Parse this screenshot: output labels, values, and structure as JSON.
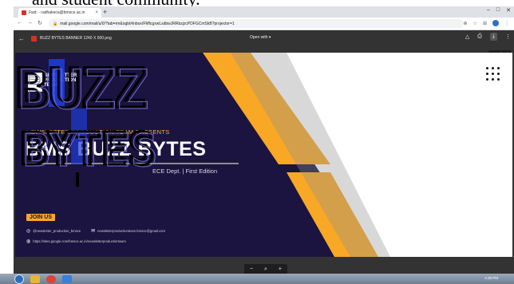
{
  "document": {
    "caption": "and student community."
  },
  "browser": {
    "tab_title": "Fwd: - radhakeca@bmsce.ac.in",
    "tab_close": "×",
    "new_tab": "+",
    "url": "mail.google.com/mail/u/0/?tab=rm&ogbl#inbox/FMfcgxwLsdbwJRRbzjzcPDFGCmSkB?projector=1",
    "avatar_letter": "N"
  },
  "viewer": {
    "back_icon": "←",
    "file_name": "BUZZ BYTES BANNER 1240 X 500.png",
    "open_with": "Open with ▾",
    "tooltip": "Download",
    "zoom_out": "−",
    "zoom_icon": "⌕",
    "zoom_in": "+"
  },
  "banner": {
    "logo_line1": "NEWSLETTER",
    "logo_line2": "PRODUCTION",
    "logo_line3": "TEAM",
    "presents": "NEWSLETTER PRODUCTION TEAM PRESENTS",
    "title": "BMS BUZZ BYTES",
    "edition": "ECE Dept. | First Edition",
    "join_us": "JOIN US",
    "instagram": "@newsletter_production_bmsce",
    "email": "newsletterproductionteam.bmsce@gmail.com",
    "website": "https://sites.google.com/bmsce.ac.in/newsletterproductionteam",
    "art_word1": "BUZZ",
    "art_word2": "BYTES"
  },
  "taskbar": {
    "clock": "4:38 PM"
  },
  "colors": {
    "navy": "#1b1340",
    "orange": "#f9a826",
    "gray_band": "#8e8e8e",
    "blue": "#1e3cd6"
  }
}
